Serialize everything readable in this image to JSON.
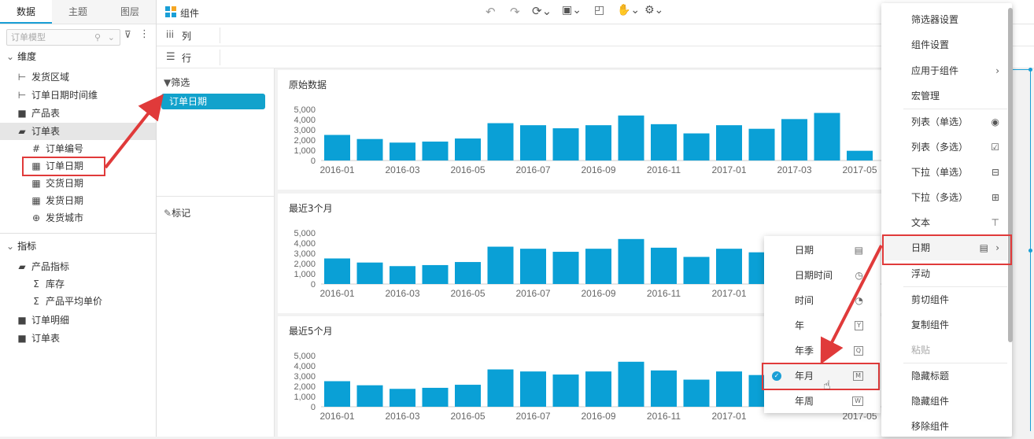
{
  "left_panel": {
    "tabs": [
      "数据",
      "主题",
      "图层"
    ],
    "search_placeholder": "订单模型",
    "dimension_header": "维度",
    "dimension_items": [
      {
        "label": "发货区域",
        "icon": "hierarchy-icon"
      },
      {
        "label": "订单日期时间维",
        "icon": "hierarchy-icon"
      },
      {
        "label": "产品表",
        "icon": "folder-icon"
      },
      {
        "label": "订单表",
        "icon": "folder-open-icon"
      },
      {
        "label": "订单编号",
        "icon": "hash-icon"
      },
      {
        "label": "订单日期",
        "icon": "date-field-icon"
      },
      {
        "label": "交货日期",
        "icon": "date-field-icon"
      },
      {
        "label": "发货日期",
        "icon": "date-field-icon"
      },
      {
        "label": "发货城市",
        "icon": "globe-icon"
      }
    ],
    "measure_header": "指标",
    "measure_items": [
      {
        "label": "产品指标",
        "icon": "folder-open-icon"
      },
      {
        "label": "库存",
        "icon": "sigma-icon"
      },
      {
        "label": "产品平均单价",
        "icon": "sigma-icon"
      },
      {
        "label": "订单明细",
        "icon": "folder-icon"
      },
      {
        "label": "订单表",
        "icon": "folder-icon"
      }
    ]
  },
  "toolbar": {
    "title": "组件"
  },
  "shelves": {
    "columns": "列",
    "rows": "行"
  },
  "filter_panel": {
    "filter_title": "筛选",
    "filter_chip": "订单日期",
    "mark_title": "标记"
  },
  "charts_text": {
    "titles": [
      "原始数据",
      "最近3个月",
      "最近5个月"
    ]
  },
  "chart_data": [
    {
      "type": "bar",
      "title": "原始数据",
      "categories": [
        "2016-01",
        "2016-02",
        "2016-03",
        "2016-04",
        "2016-05",
        "2016-06",
        "2016-07",
        "2016-08",
        "2016-09",
        "2016-10",
        "2016-11",
        "2016-12",
        "2017-01",
        "2017-02",
        "2017-03",
        "2017-04",
        "2017-05"
      ],
      "tick_labels": [
        "2016-01",
        "2016-03",
        "2016-05",
        "2016-07",
        "2016-09",
        "2016-11",
        "2017-01",
        "2017-03",
        "2017-05"
      ],
      "values": [
        2500,
        2100,
        1750,
        1850,
        2150,
        3650,
        3450,
        3150,
        3450,
        4400,
        3550,
        2650,
        3450,
        3100,
        4050,
        4650,
        950
      ],
      "yticks": [
        "5,000",
        "4,000",
        "3,000",
        "2,000",
        "1,000",
        "0"
      ],
      "ylim": [
        0,
        5000
      ]
    },
    {
      "type": "bar",
      "title": "最近3个月",
      "categories": [
        "2016-01",
        "2016-02",
        "2016-03",
        "2016-04",
        "2016-05",
        "2016-06",
        "2016-07",
        "2016-08",
        "2016-09",
        "2016-10",
        "2016-11",
        "2016-12",
        "2017-01",
        "2017-02"
      ],
      "tick_labels": [
        "2016-01",
        "2016-03",
        "2016-05",
        "2016-07",
        "2016-09",
        "2016-11",
        "2017-01"
      ],
      "values": [
        2500,
        2100,
        1750,
        1850,
        2150,
        3650,
        3450,
        3150,
        3450,
        4400,
        3550,
        2650,
        3450,
        3100
      ],
      "yticks": [
        "5,000",
        "4,000",
        "3,000",
        "2,000",
        "1,000",
        "0"
      ],
      "ylim": [
        0,
        5000
      ]
    },
    {
      "type": "bar",
      "title": "最近5个月",
      "categories": [
        "2016-01",
        "2016-02",
        "2016-03",
        "2016-04",
        "2016-05",
        "2016-06",
        "2016-07",
        "2016-08",
        "2016-09",
        "2016-10",
        "2016-11",
        "2016-12",
        "2017-01",
        "2017-02"
      ],
      "tick_labels": [
        "2016-01",
        "2016-03",
        "2016-05",
        "2016-07",
        "2016-09",
        "2016-11",
        "2017-01",
        "2017-05"
      ],
      "values": [
        2500,
        2100,
        1750,
        1850,
        2150,
        3650,
        3450,
        3150,
        3450,
        4400,
        3550,
        2650,
        3450,
        3100
      ],
      "yticks": [
        "5,000",
        "4,000",
        "3,000",
        "2,000",
        "1,000",
        "0"
      ],
      "ylim": [
        0,
        5000
      ]
    }
  ],
  "context_menu": {
    "items": [
      {
        "label": "筛选器设置"
      },
      {
        "label": "组件设置"
      },
      {
        "label": "应用于组件",
        "right": "›"
      },
      {
        "label": "宏管理"
      },
      {
        "label": "列表（单选）",
        "icon": "radio-icon"
      },
      {
        "label": "列表（多选）",
        "icon": "checkbox-icon"
      },
      {
        "label": "下拉（单选）",
        "icon": "dropdown-single-icon"
      },
      {
        "label": "下拉（多选）",
        "icon": "dropdown-multi-icon"
      },
      {
        "label": "文本",
        "icon": "text-box-icon"
      },
      {
        "label": "日期",
        "icon": "calendar-list-icon",
        "right": "›"
      },
      {
        "label": "浮动"
      },
      {
        "label": "剪切组件"
      },
      {
        "label": "复制组件"
      },
      {
        "label": "粘贴",
        "disabled": true
      },
      {
        "label": "隐藏标题"
      },
      {
        "label": "隐藏组件"
      },
      {
        "label": "移除组件"
      }
    ]
  },
  "date_submenu": {
    "items": [
      {
        "label": "日期",
        "icon": "calendar-icon"
      },
      {
        "label": "日期时间",
        "icon": "calendar-clock-icon"
      },
      {
        "label": "时间",
        "icon": "clock-icon"
      },
      {
        "label": "年",
        "icon": "year-icon",
        "glyph": "Y"
      },
      {
        "label": "年季",
        "icon": "quarter-icon",
        "glyph": "Q"
      },
      {
        "label": "年月",
        "icon": "month-icon",
        "glyph": "M",
        "checked": true
      },
      {
        "label": "年周",
        "icon": "week-icon",
        "glyph": "W"
      }
    ]
  },
  "colors": {
    "bar": "#0aa0d6",
    "highlight_box": "#e03a3a",
    "accent": "#12a2cc"
  }
}
